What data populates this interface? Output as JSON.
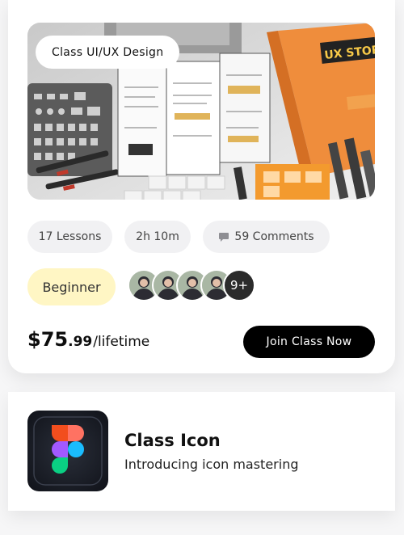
{
  "course": {
    "tag": "Class UI/UX Design",
    "chips": {
      "lessons": "17 Lessons",
      "duration": "2h 10m",
      "comments": "59 Comments"
    },
    "level": "Beginner",
    "attendees_more": "9+",
    "price": {
      "currency": "$",
      "whole": "75",
      "cents": ".99",
      "period": "/lifetime"
    },
    "cta": "Join Class Now"
  },
  "hero_image": {
    "icons": [
      "ux-stencil",
      "orange-book",
      "pens",
      "wireframe-sketches"
    ],
    "book_text": "UX STORY"
  },
  "next_course": {
    "icon": "figma-icon",
    "title": "Class Icon",
    "subtitle": "Introducing icon mastering"
  },
  "colors": {
    "accent_black": "#000000",
    "level_bg": "#fff6c4",
    "chip_bg": "#f1f1f3"
  }
}
